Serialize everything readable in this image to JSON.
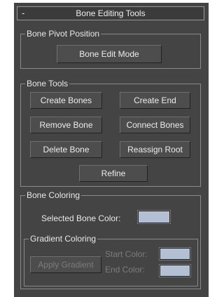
{
  "rollout": {
    "collapse_symbol": "-",
    "title": "Bone Editing Tools"
  },
  "bone_pivot_position": {
    "label": "Bone Pivot Position",
    "edit_mode_button": "Bone Edit Mode"
  },
  "bone_tools": {
    "label": "Bone Tools",
    "create_bones": "Create Bones",
    "create_end": "Create End",
    "remove_bone": "Remove Bone",
    "connect_bones": "Connect Bones",
    "delete_bone": "Delete Bone",
    "reassign_root": "Reassign Root",
    "refine": "Refine"
  },
  "bone_coloring": {
    "label": "Bone Coloring",
    "selected_color_label": "Selected Bone Color:",
    "selected_color": "#b3c0d3",
    "gradient": {
      "label": "Gradient Coloring",
      "apply_button": "Apply Gradient",
      "start_label": "Start Color:",
      "end_label": "End Color:",
      "start_color": "#b3c0d3",
      "end_color": "#b3c0d3"
    }
  }
}
